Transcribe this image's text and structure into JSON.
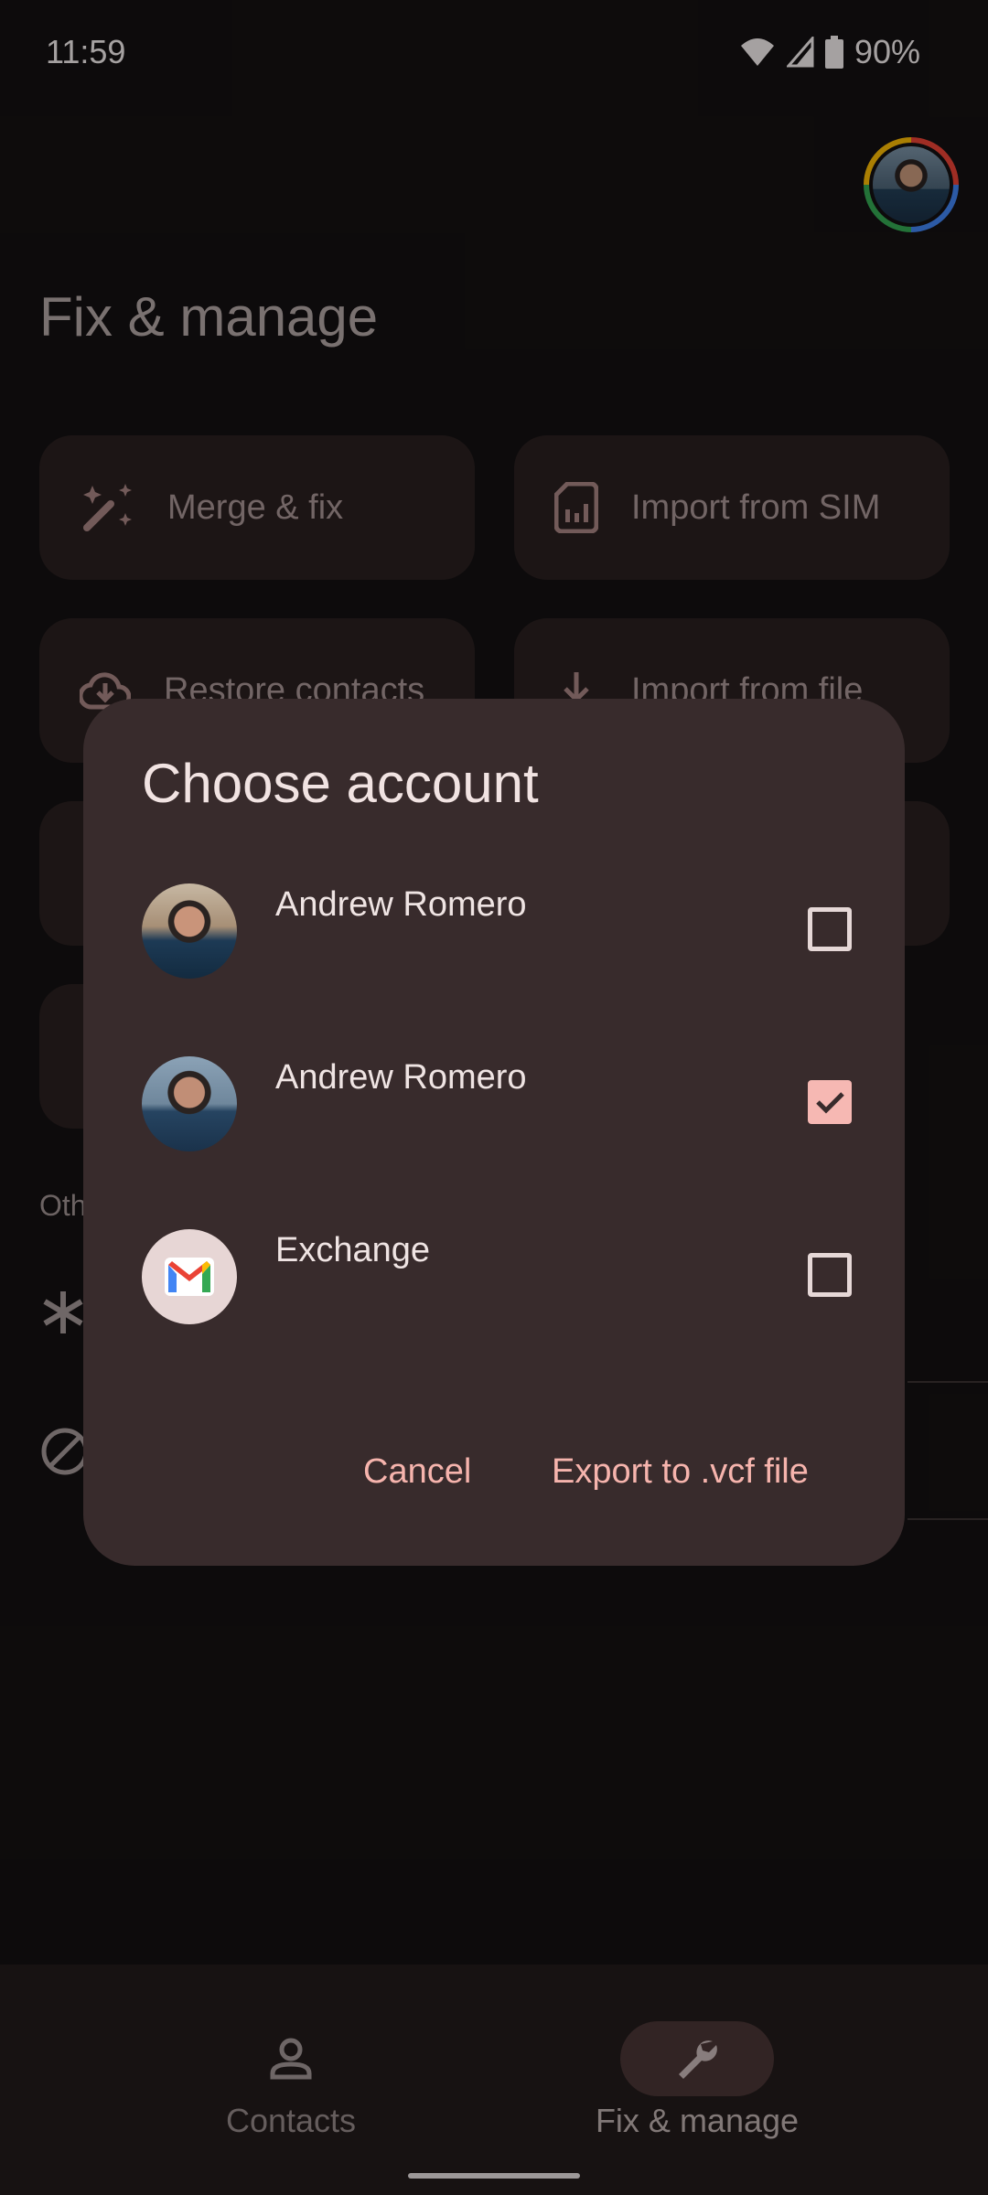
{
  "status_bar": {
    "time": "11:59",
    "battery": "90%",
    "icons": [
      "wifi-icon",
      "cell-signal-icon",
      "battery-icon"
    ]
  },
  "header": {
    "title": "Fix & manage"
  },
  "tiles": [
    {
      "label": "Merge & fix",
      "icon": "magic-wand-icon"
    },
    {
      "label": "Import from SIM",
      "icon": "sim-card-icon"
    },
    {
      "label": "Restore contacts",
      "icon": "cloud-download-icon"
    },
    {
      "label": "Import from file",
      "icon": "download-icon"
    }
  ],
  "other_section": {
    "label": "Oth"
  },
  "dialog": {
    "title": "Choose account",
    "accounts": [
      {
        "name": "Andrew Romero",
        "checked": false,
        "avatar": "profile-photo"
      },
      {
        "name": "Andrew Romero",
        "checked": true,
        "avatar": "profile-photo"
      },
      {
        "name": "Exchange",
        "checked": false,
        "avatar": "gmail-icon"
      }
    ],
    "cancel_label": "Cancel",
    "export_label": "Export to .vcf file"
  },
  "bottom_nav": {
    "items": [
      {
        "label": "Contacts",
        "icon": "person-icon",
        "active": false
      },
      {
        "label": "Fix & manage",
        "icon": "wrench-icon",
        "active": true
      }
    ]
  },
  "colors": {
    "background": "#141112",
    "dialog": "#382b2c",
    "accent": "#f6b4ad",
    "tile": "#2a2020"
  }
}
